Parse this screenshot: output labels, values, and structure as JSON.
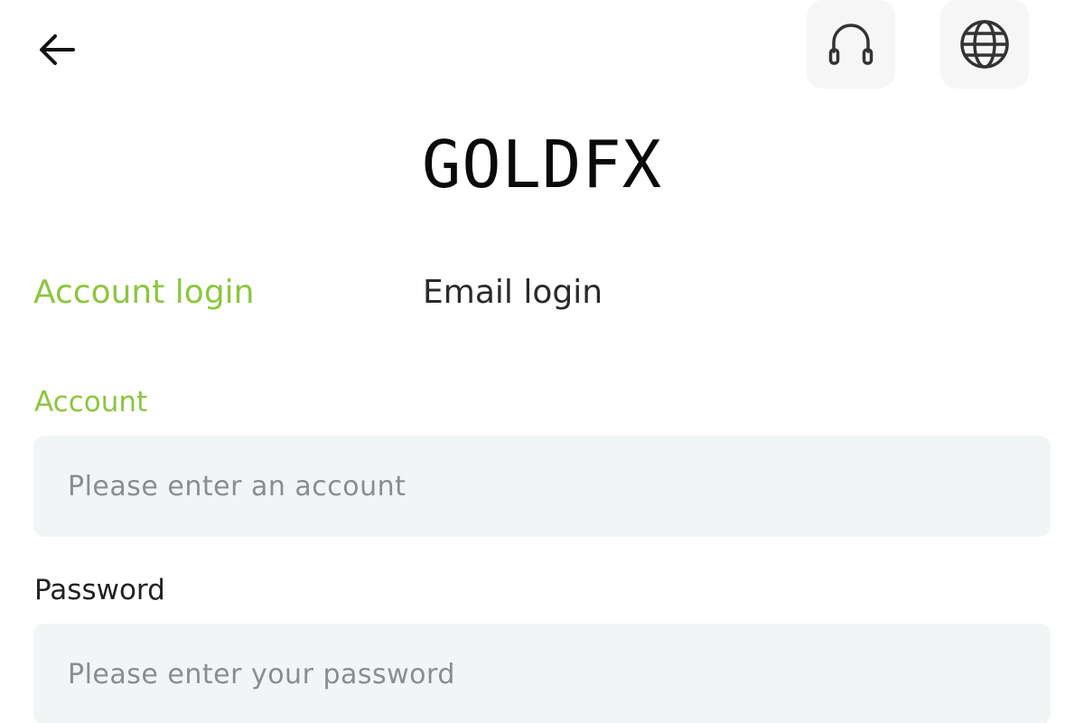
{
  "header": {
    "brand": "GOLDFX",
    "back_icon": "arrow-left-icon",
    "support_icon": "headset-icon",
    "language_icon": "globe-icon"
  },
  "tabs": [
    {
      "label": "Account login",
      "active": true
    },
    {
      "label": "Email login",
      "active": false
    }
  ],
  "form": {
    "account": {
      "label": "Account",
      "placeholder": "Please enter an account",
      "value": ""
    },
    "password": {
      "label": "Password",
      "placeholder": "Please enter your password",
      "value": ""
    }
  },
  "colors": {
    "accent": "#8cc63f",
    "text": "#222222",
    "input_bg": "#f2f5f6",
    "icon_bg": "#f6f6f6",
    "placeholder": "#8a8d90"
  }
}
